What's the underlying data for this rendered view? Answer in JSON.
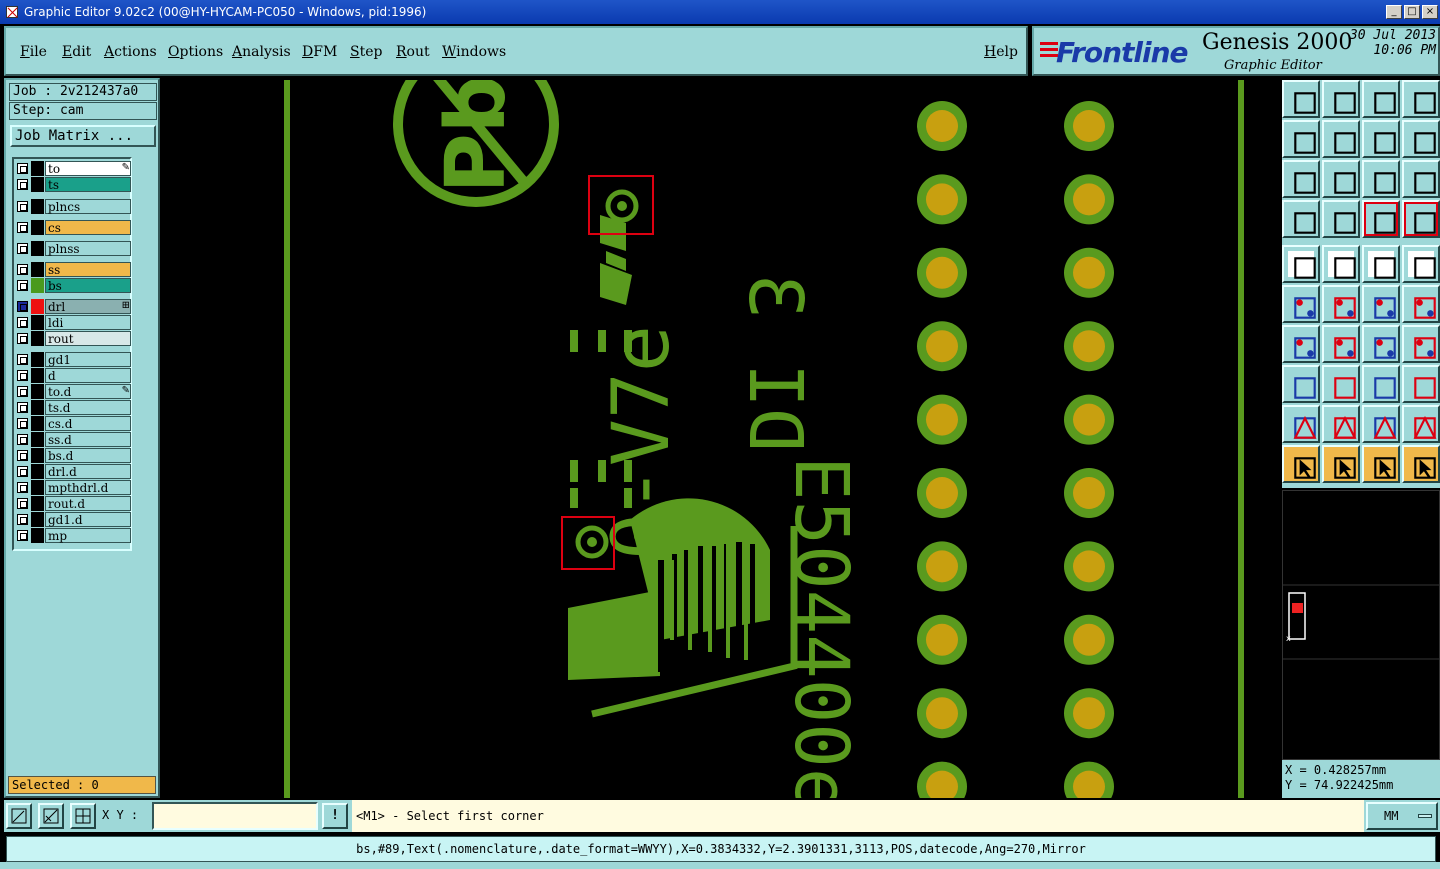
{
  "window": {
    "title": "Graphic Editor 9.02c2 (00@HY-HYCAM-PC050 - Windows, pid:1996)",
    "minimize": "_",
    "maximize": "□",
    "close": "×"
  },
  "menu": [
    "File",
    "Edit",
    "Actions",
    "Options",
    "Analysis",
    "DFM",
    "Step",
    "Rout",
    "Windows"
  ],
  "help": "Help",
  "brand": {
    "logo": "Frontline",
    "product": "Genesis 2000",
    "subtitle": "Graphic Editor",
    "date": "30 Jul 2013",
    "time": "10:06 PM"
  },
  "job": {
    "job_line": "Job : 2v212437a0",
    "step_line": "Step: cam",
    "matrix_button": "Job Matrix ..."
  },
  "layers": [
    {
      "name": "to",
      "swatch": "#000000",
      "bg": "#ffffff",
      "mark": "✎"
    },
    {
      "name": "ts",
      "swatch": "#000000",
      "bg": "#1aa08a",
      "mark": ""
    },
    {
      "name": "plncs",
      "swatch": "#000000",
      "bg": "#9ed8d8",
      "mark": ""
    },
    {
      "name": "cs",
      "swatch": "#000000",
      "bg": "#f0b84a",
      "mark": ""
    },
    {
      "name": "plnss",
      "swatch": "#000000",
      "bg": "#9ed8d8",
      "mark": ""
    },
    {
      "name": "ss",
      "swatch": "#000000",
      "bg": "#f0b84a",
      "mark": ""
    },
    {
      "name": "bs",
      "swatch": "#4a9a1e",
      "bg": "#1aa08a",
      "mark": ""
    },
    {
      "name": "drl",
      "swatch": "#ee1111",
      "bg": "#8ab0b0",
      "mark": "⊞"
    },
    {
      "name": "ldi",
      "swatch": "#000000",
      "bg": "#9ed8d8",
      "mark": ""
    },
    {
      "name": "rout",
      "swatch": "#000000",
      "bg": "#d8e8e8",
      "mark": ""
    },
    {
      "name": "gd1",
      "swatch": "#000000",
      "bg": "#9ed8d8",
      "mark": ""
    },
    {
      "name": "d",
      "swatch": "#000000",
      "bg": "#9ed8d8",
      "mark": ""
    },
    {
      "name": "to.d",
      "swatch": "#000000",
      "bg": "#9ed8d8",
      "mark": "✎"
    },
    {
      "name": "ts.d",
      "swatch": "#000000",
      "bg": "#9ed8d8",
      "mark": ""
    },
    {
      "name": "cs.d",
      "swatch": "#000000",
      "bg": "#9ed8d8",
      "mark": ""
    },
    {
      "name": "ss.d",
      "swatch": "#000000",
      "bg": "#9ed8d8",
      "mark": ""
    },
    {
      "name": "bs.d",
      "swatch": "#000000",
      "bg": "#9ed8d8",
      "mark": ""
    },
    {
      "name": "drl.d",
      "swatch": "#000000",
      "bg": "#9ed8d8",
      "mark": ""
    },
    {
      "name": "mpthdrl.d",
      "swatch": "#000000",
      "bg": "#9ed8d8",
      "mark": ""
    },
    {
      "name": "rout.d",
      "swatch": "#000000",
      "bg": "#9ed8d8",
      "mark": ""
    },
    {
      "name": "gd1.d",
      "swatch": "#000000",
      "bg": "#9ed8d8",
      "mark": ""
    },
    {
      "name": "mp",
      "swatch": "#000000",
      "bg": "#9ed8d8",
      "mark": ""
    }
  ],
  "selected": "Selected : 0",
  "canvas": {
    "text_line1": "0-V7e",
    "text_line2": "DI 3",
    "text_line3": "E504400e",
    "pcb_green": "#5a9a1e",
    "pad_fill": "#c8a010"
  },
  "coords": {
    "x": "X = 0.428257mm",
    "y": "Y = 74.922425mm"
  },
  "bottom": {
    "xy_label": "X Y :",
    "xy_value": "",
    "bang": "!",
    "prompt": "<M1> - Select first corner",
    "units": "MM"
  },
  "status": "bs,#89,Text(.nomenclature,.date_format=WWYY),X=0.3834332,Y=2.3901331,3113,POS,datecode,Ang=270,Mirror"
}
